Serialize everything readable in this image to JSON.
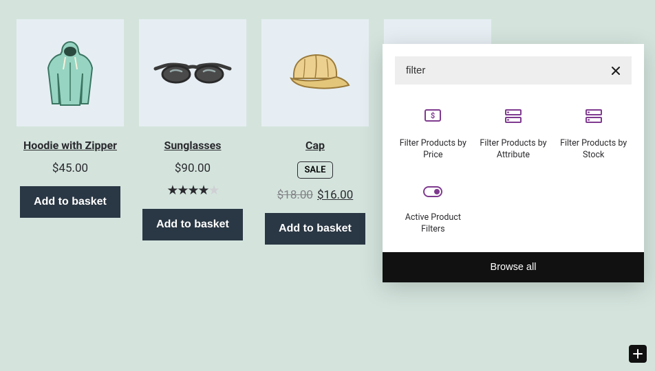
{
  "products": [
    {
      "title": "Hoodie with Zipper",
      "price": "$45.00",
      "cta": "Add to basket"
    },
    {
      "title": "Sunglasses",
      "price": "$90.00",
      "rating": 4,
      "cta": "Add to basket"
    },
    {
      "title": "Cap",
      "sale_badge": "SALE",
      "price_old": "$18.00",
      "price_new": "$16.00",
      "cta": "Add to basket"
    }
  ],
  "inserter": {
    "search_value": "filter",
    "blocks": [
      {
        "label": "Filter Products by Price",
        "icon": "price"
      },
      {
        "label": "Filter Products by Attribute",
        "icon": "attr"
      },
      {
        "label": "Filter Products by Stock",
        "icon": "stock"
      },
      {
        "label": "Active Product Filters",
        "icon": "active"
      }
    ],
    "browse_all": "Browse all"
  },
  "colors": {
    "accent": "#7f3a8f"
  }
}
